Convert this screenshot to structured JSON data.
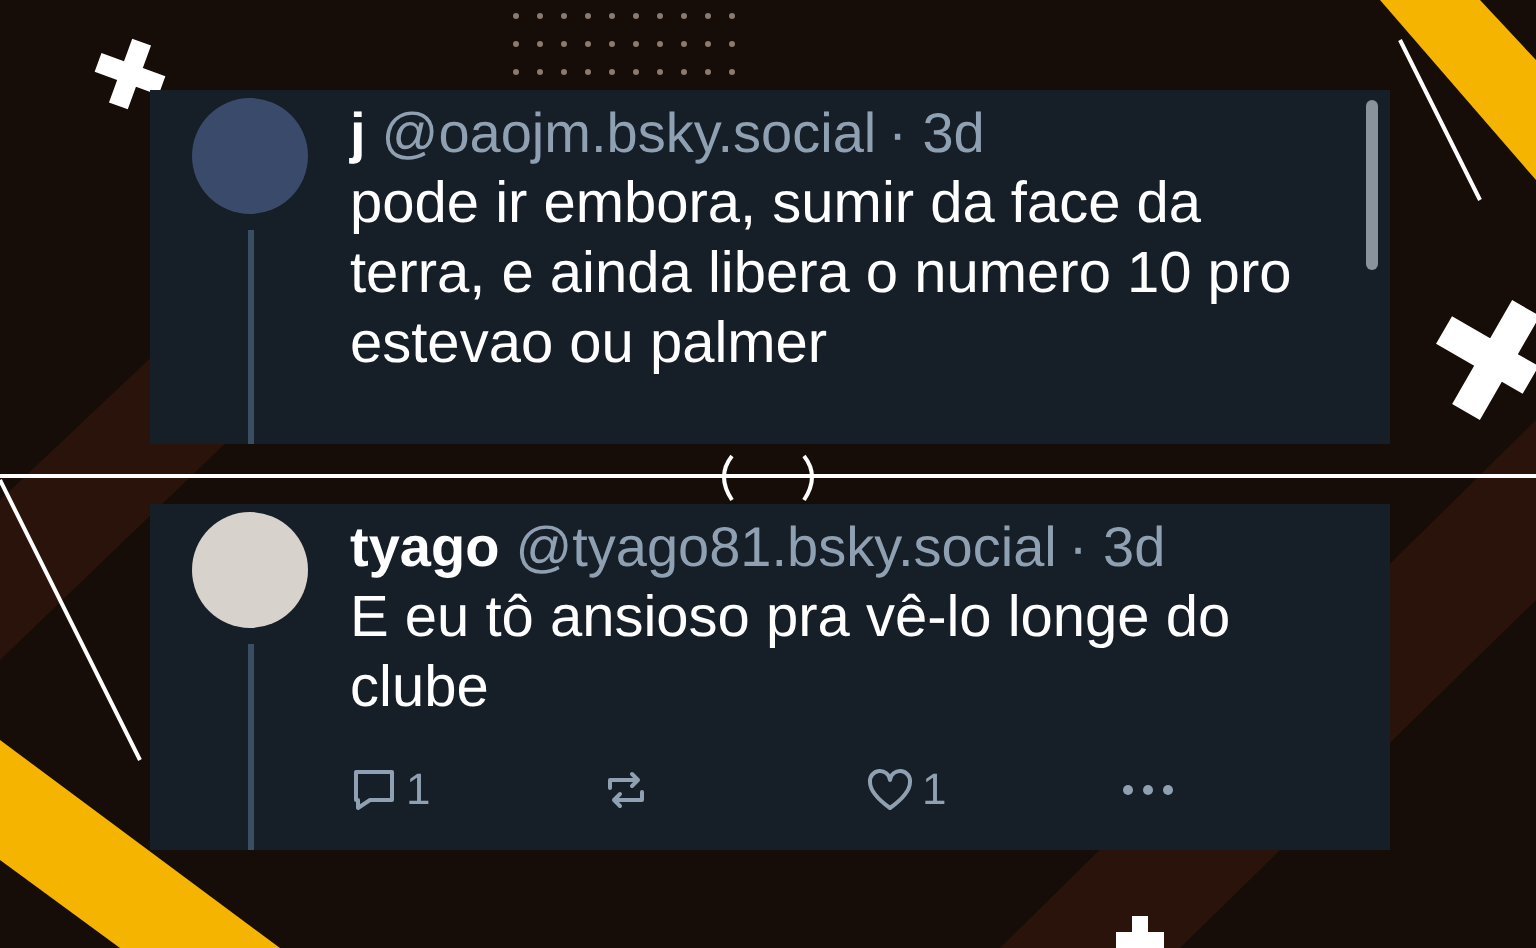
{
  "posts": [
    {
      "display_name": "j",
      "handle": "@oaojm.bsky.social",
      "time": "· 3d",
      "text": "pode ir embora, sumir da face da terra, e ainda libera o numero 10 pro estevao ou palmer",
      "scrollbar": true
    },
    {
      "display_name": "tyago",
      "handle": "@tyago81.bsky.social",
      "time": "· 3d",
      "text": "E eu tô ansioso pra vê-lo longe do clube",
      "scrollbar": false,
      "actions": {
        "replies": "1",
        "likes": "1"
      }
    }
  ]
}
